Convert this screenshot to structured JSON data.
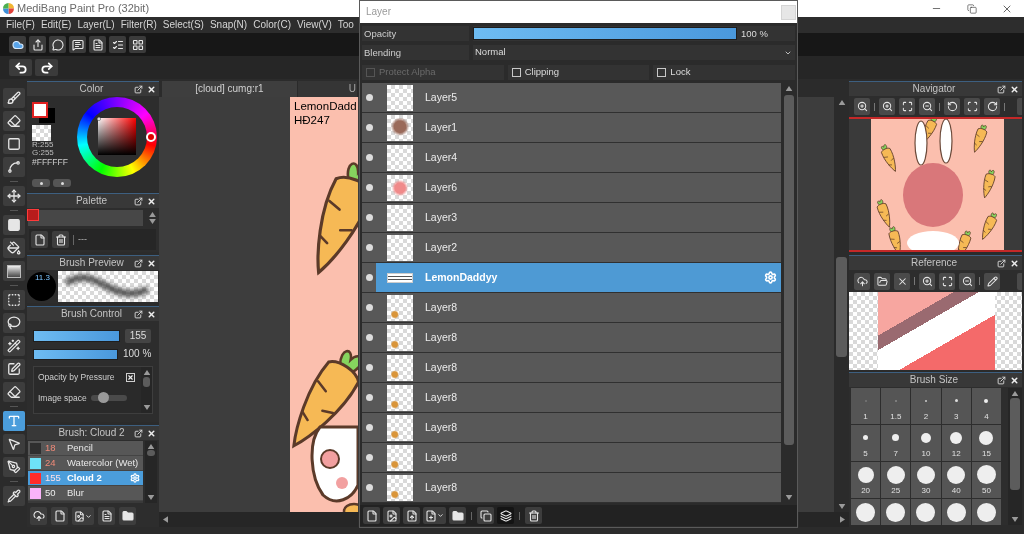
{
  "window": {
    "title": "MediBang Paint Pro (32bit)"
  },
  "menu": [
    "File(F)",
    "Edit(E)",
    "Layer(L)",
    "Filter(R)",
    "Select(S)",
    "Snap(N)",
    "Color(C)",
    "View(V)",
    "Too"
  ],
  "tools": [
    {
      "selected": false
    },
    {
      "selected": false
    },
    {
      "selected": false
    },
    {
      "selected": false
    },
    {
      "selected": false
    },
    {
      "selected": false
    },
    {
      "selected": false
    },
    {
      "selected": false
    },
    {
      "selected": false
    },
    {
      "selected": false
    },
    {
      "selected": false
    },
    {
      "selected": false
    },
    {
      "selected": false
    },
    {
      "selected": true
    },
    {
      "selected": false
    },
    {
      "selected": false
    },
    {
      "selected": false
    }
  ],
  "color_panel": {
    "title": "Color",
    "values": [
      "R:255",
      "G:255"
    ],
    "hex": "#FFFFFF"
  },
  "palette_panel": {
    "title": "Palette",
    "swatches": [
      {
        "color": "#b81c1c",
        "selected": true
      }
    ],
    "label": "---"
  },
  "brush_preview_panel": {
    "title": "Brush Preview",
    "size": "11.3"
  },
  "brush_control_panel": {
    "title": "Brush Control",
    "sliders": [
      {
        "kind": "spin",
        "level": 1,
        "value": "155"
      },
      {
        "kind": "percent",
        "level": 1,
        "value": "100 %"
      }
    ],
    "options": [
      {
        "kind": "checkbox",
        "label": "Opacity by Pressure",
        "checked": true
      },
      {
        "kind": "slider",
        "label": "Image space",
        "level": 0.25
      }
    ]
  },
  "brush_panel": {
    "title": "Brush: Cloud 2",
    "brushes": [
      {
        "color": "#2f2f2f",
        "size": "18",
        "name": "Pencil",
        "selected": false,
        "size_highlighted": true
      },
      {
        "color": "#6ee2f7",
        "size": "24",
        "name": "Watercolor (Wet)",
        "selected": false,
        "size_highlighted": true
      },
      {
        "color": "#ff2b2b",
        "size": "155",
        "name": "Cloud 2",
        "selected": true,
        "size_highlighted": true
      },
      {
        "color": "#f9b3f9",
        "size": "50",
        "name": "Blur",
        "selected": false,
        "size_highlighted": false
      }
    ]
  },
  "canvas": {
    "tabs": [
      {
        "label": "[cloud] cumg:r1",
        "selected": true
      },
      {
        "label": "U",
        "selected": false
      }
    ],
    "artwork_text": [
      "LemonDadd",
      "HĐ247"
    ]
  },
  "layer_window": {
    "title": "Layer",
    "opacity": {
      "label": "Opacity",
      "level": 1,
      "value": "100 %"
    },
    "blending": {
      "label": "Blending",
      "value": "Normal"
    },
    "options": [
      {
        "label": "Protect Alpha",
        "checked": false,
        "disabled": true
      },
      {
        "label": "Clipping",
        "checked": false,
        "disabled": false
      },
      {
        "label": "Lock",
        "checked": false,
        "disabled": false
      }
    ],
    "layers": [
      {
        "name": "Layer5",
        "kind": "raster",
        "visible": true,
        "selected": false
      },
      {
        "name": "Layer1",
        "kind": "raster",
        "visible": true,
        "selected": false
      },
      {
        "name": "Layer4",
        "kind": "raster",
        "visible": true,
        "selected": false
      },
      {
        "name": "Layer6",
        "kind": "raster",
        "visible": true,
        "selected": false
      },
      {
        "name": "Layer3",
        "kind": "raster",
        "visible": true,
        "selected": false
      },
      {
        "name": "Layer2",
        "kind": "raster",
        "visible": true,
        "selected": false
      },
      {
        "name": "LemonDaddyy",
        "kind": "text",
        "visible": true,
        "selected": true
      },
      {
        "name": "Layer8",
        "kind": "raster",
        "visible": true,
        "selected": false
      },
      {
        "name": "Layer8",
        "kind": "raster",
        "visible": true,
        "selected": false
      },
      {
        "name": "Layer8",
        "kind": "raster",
        "visible": true,
        "selected": false
      },
      {
        "name": "Layer8",
        "kind": "raster",
        "visible": true,
        "selected": false
      },
      {
        "name": "Layer8",
        "kind": "raster",
        "visible": true,
        "selected": false
      },
      {
        "name": "Layer8",
        "kind": "raster",
        "visible": true,
        "selected": false
      },
      {
        "name": "Layer8",
        "kind": "raster",
        "visible": true,
        "selected": false
      }
    ]
  },
  "navigator_panel": {
    "title": "Navigator"
  },
  "reference_panel": {
    "title": "Reference"
  },
  "brush_size_panel": {
    "title": "Brush Size",
    "sizes": [
      "1",
      "1.5",
      "2",
      "3",
      "4",
      "5",
      "7",
      "10",
      "12",
      "15",
      "20",
      "25",
      "30",
      "40",
      "50"
    ]
  }
}
